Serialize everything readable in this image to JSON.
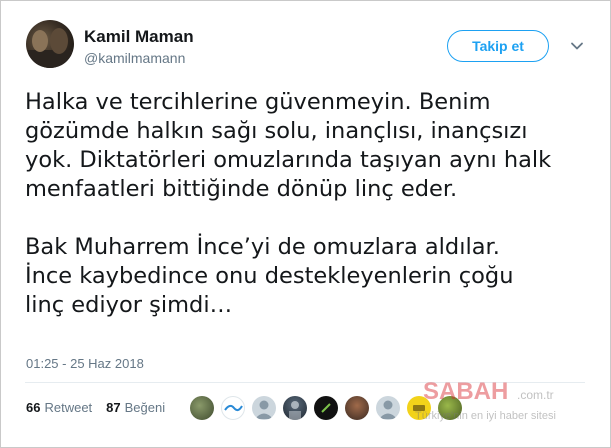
{
  "author": {
    "display_name": "Kamil Maman",
    "handle": "@kamilmamann"
  },
  "follow_button": {
    "label": "Takip et"
  },
  "tweet": {
    "paragraph1": [
      "Halka ve tercihlerine güvenmeyin. Benim",
      "gözümde halkın sağı solu, inançlısı, inançsızı",
      "yok. Diktatörleri omuzlarında taşıyan aynı halk",
      "menfaatleri bittiğinde dönüp linç eder."
    ],
    "paragraph2": [
      "Bak Muharrem İnce’yi de omuzlara aldılar.",
      "İnce kaybedince onu destekleyenlerin çoğu",
      "linç ediyor şimdi…"
    ],
    "timestamp": "01:25 - 25 Haz 2018"
  },
  "stats": {
    "retweets": {
      "count": "66",
      "label": "Retweet"
    },
    "likes": {
      "count": "87",
      "label": "Beğeni"
    }
  },
  "liker_avatars": [
    "avatar-1",
    "avatar-2",
    "avatar-3",
    "avatar-4",
    "avatar-5",
    "avatar-6",
    "avatar-7",
    "avatar-8",
    "avatar-9"
  ],
  "watermark": {
    "logo": "SABAH",
    "suffix": ".com.tr",
    "tagline": "Türkiye'nin en iyi haber sitesi"
  },
  "colors": {
    "accent": "#1da1f2",
    "text": "#14171a",
    "muted": "#657786",
    "watermark_red": "#d9272e"
  },
  "icons": {
    "caret": "chevron-down-icon"
  }
}
